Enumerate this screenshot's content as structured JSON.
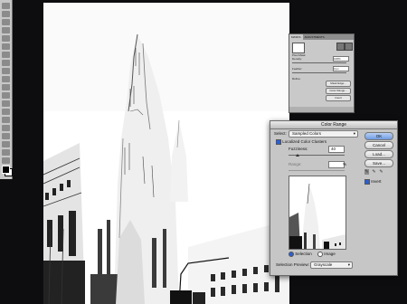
{
  "masks_panel": {
    "tabs": [
      "MASKS",
      "ADJUSTMENTS"
    ],
    "mask_type": "Pixel Mask",
    "density_label": "Density:",
    "density_value": "100%",
    "feather_label": "Feather:",
    "feather_value": "0 px",
    "refine_label": "Refine:",
    "mask_edge_button": "Mask Edge...",
    "color_range_button": "Color Range...",
    "invert_button": "Invert"
  },
  "color_range": {
    "title": "Color Range",
    "select_label": "Select:",
    "select_value": "Sampled Colors",
    "localized_label": "Localized Color Clusters",
    "localized_checked": true,
    "fuzziness_label": "Fuzziness:",
    "fuzziness_value": "40",
    "range_label": "Range:",
    "range_unit": "%",
    "selection_label": "Selection",
    "image_label": "Image",
    "selection_checked": true,
    "preview_label": "Selection Preview:",
    "preview_value": "Grayscale",
    "ok_button": "OK",
    "cancel_button": "Cancel",
    "load_button": "Load...",
    "save_button": "Save...",
    "invert_label": "Invert",
    "invert_checked": true,
    "eyedropper_icons": [
      "eyedropper-icon",
      "eyedropper-plus-icon",
      "eyedropper-minus-icon"
    ]
  },
  "colors": {
    "background": "#0d0d10",
    "panel": "#c6c6c6",
    "accent": "#2a5fd6"
  }
}
